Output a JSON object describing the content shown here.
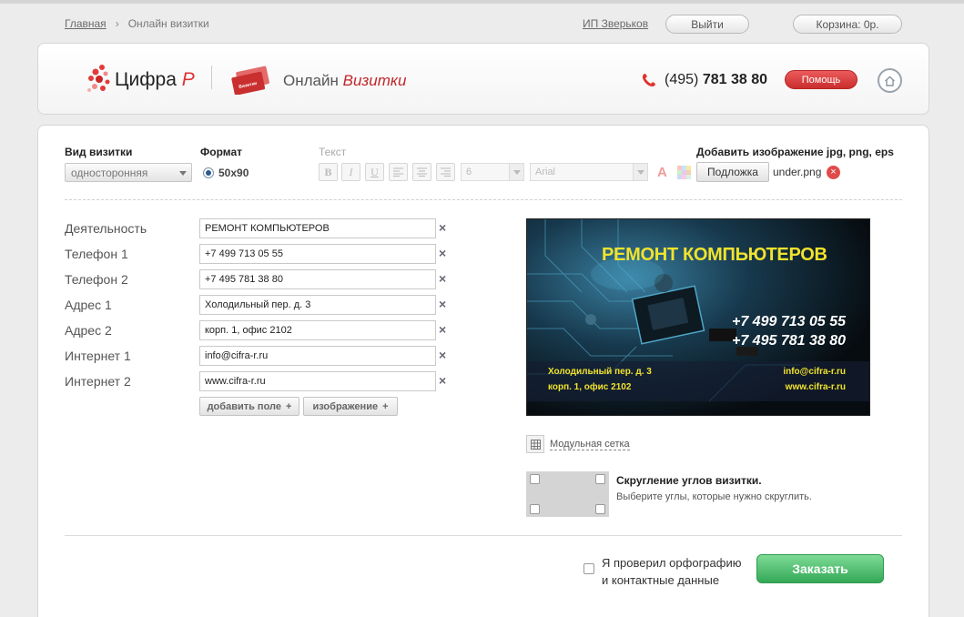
{
  "nav": {
    "breadcrumb_home": "Главная",
    "breadcrumb_sep": "›",
    "breadcrumb_current": "Онлайн визитки",
    "user": "ИП Зверьков",
    "logout": "Выйти",
    "cart": "Корзина: 0р."
  },
  "header": {
    "logo_text": "Цифра",
    "logo_letter": "Р",
    "cards_icon_text": "Визитки",
    "product_prefix": "Онлайн",
    "product_accent": "Визитки",
    "phone_code": "(495)",
    "phone_number": "781 38 80",
    "help": "Помощь"
  },
  "settings": {
    "type_label": "Вид визитки",
    "type_value": "односторонняя",
    "format_label": "Формат",
    "format_value": "50x90",
    "text_label": "Текст",
    "bold": "B",
    "italic": "I",
    "underline": "U",
    "font_size": "6",
    "font_family": "Arial",
    "color_glyph": "A",
    "add_image_label": "Добавить изображение jpg, png, eps",
    "underlay_button": "Подложка",
    "underlay_file": "under.png",
    "remove_glyph": "×"
  },
  "fields": [
    {
      "label": "Деятельность",
      "value": "РЕМОНТ КОМПЬЮТЕРОВ"
    },
    {
      "label": "Телефон 1",
      "value": "+7 499 713 05 55"
    },
    {
      "label": "Телефон 2",
      "value": "+7 495 781 38 80"
    },
    {
      "label": "Адрес 1",
      "value": "Холодильный пер. д. 3"
    },
    {
      "label": "Адрес 2",
      "value": "корп. 1, офис 2102"
    },
    {
      "label": "Интернет 1",
      "value": "info@cifra-r.ru"
    },
    {
      "label": "Интернет 2",
      "value": "www.cifra-r.ru"
    }
  ],
  "field_delete": "×",
  "buttons": {
    "add_field": "добавить поле",
    "add_image": "изображение",
    "plus": "+"
  },
  "preview": {
    "title": "РЕМОНТ КОМПЬЮТЕРОВ",
    "phone1": "+7 499 713 05 55",
    "phone2": "+7 495 781 38 80",
    "address1": "Холодильный пер. д. 3",
    "address2": "корп. 1, офис 2102",
    "email": "info@cifra-r.ru",
    "site": "www.cifra-r.ru",
    "title_color": "#f1e32c"
  },
  "grid_link": "Модульная сетка",
  "corners": {
    "title": "Скругление углов визитки.",
    "hint": "Выберите углы, которые нужно скруглить."
  },
  "order": {
    "confirm_line1": "Я проверил орфографию",
    "confirm_line2": "и контактные данные",
    "button": "Заказать",
    "button_color": "#33a857"
  },
  "colors": {
    "accent_red": "#c0262b",
    "help_red": "#d93a3a"
  }
}
